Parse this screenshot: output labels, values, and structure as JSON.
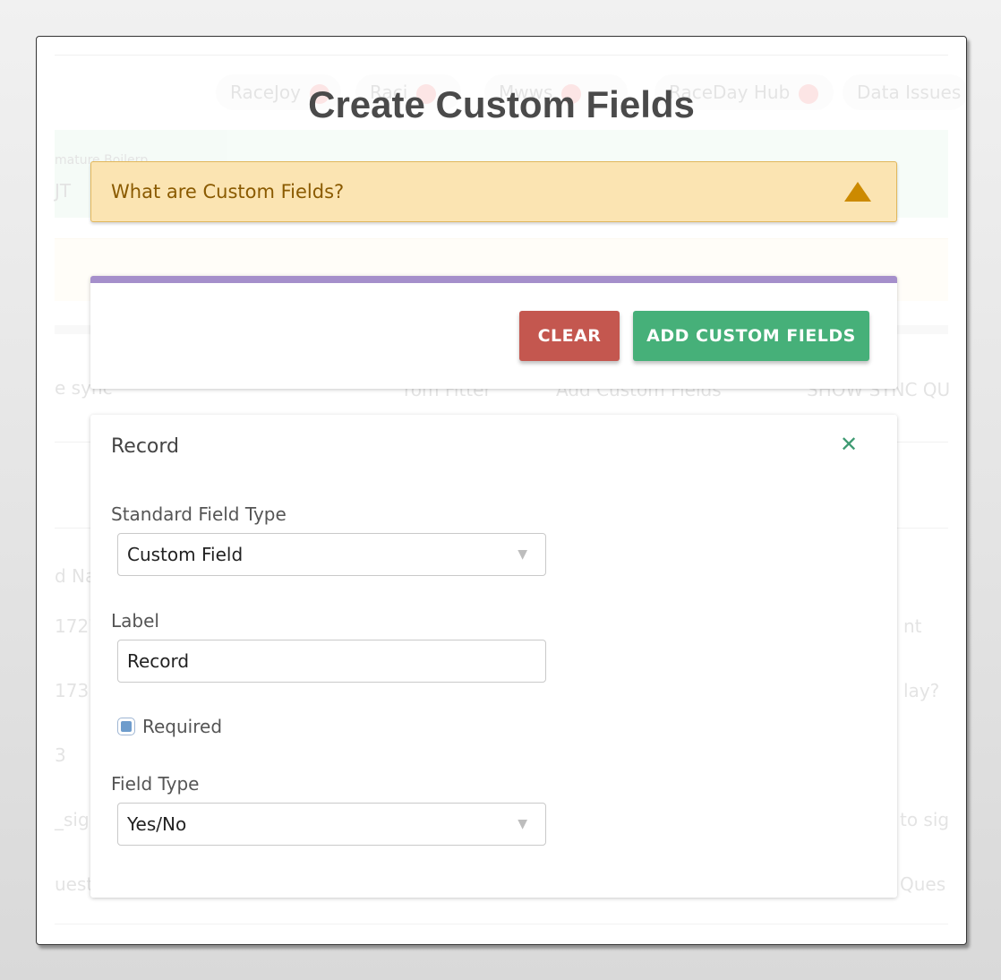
{
  "background": {
    "tabs": [
      {
        "label": "RaceJoy"
      },
      {
        "label": "Raci"
      },
      {
        "label": "Mwws"
      },
      {
        "label": "RaceDay Hub"
      },
      {
        "label": "Data Issues"
      }
    ],
    "green_line1": "mature Boilerp",
    "green_line2": "JT",
    "sync_text": "e sync",
    "col_buttons": [
      "rom Fitter",
      "Add Custom Fields",
      "SHOW SYNC QU"
    ],
    "col_header": "d Na",
    "row_texts": [
      "1727",
      "1731",
      "3",
      "_sign",
      "uest"
    ],
    "right_texts": [
      "nt",
      "lay?",
      "to sig",
      "Ques"
    ]
  },
  "modal": {
    "title": "Create Custom Fields"
  },
  "info_bar": {
    "label": "What are Custom Fields?",
    "icon": "triangle-up-icon",
    "color": "#fbe4b2"
  },
  "actions": {
    "clear_label": "CLEAR",
    "add_label": "ADD CUSTOM FIELDS",
    "accent_color": "#a58fcb",
    "clear_color": "#c4574f",
    "add_color": "#46b079"
  },
  "record": {
    "title": "Record",
    "close_icon": "close-icon",
    "standard_field_type": {
      "label": "Standard Field Type",
      "value": "Custom Field"
    },
    "label_field": {
      "label": "Label",
      "value": "Record"
    },
    "required": {
      "label": "Required",
      "checked": true
    },
    "field_type": {
      "label": "Field Type",
      "value": "Yes/No"
    }
  }
}
